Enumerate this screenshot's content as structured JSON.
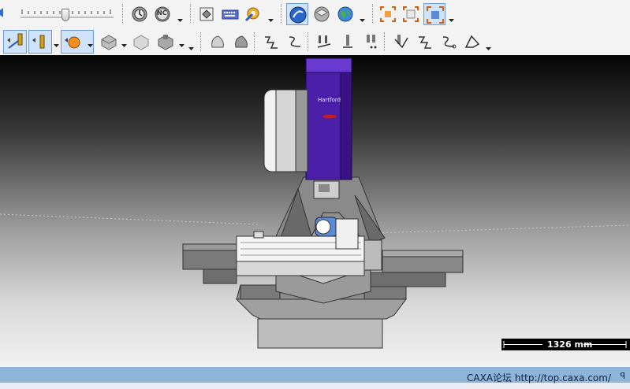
{
  "toolbar": {
    "zoom_slider": {
      "value": 0.48
    },
    "nc_button_label": "NC"
  },
  "viewport": {
    "background_top": "#050505",
    "background_bottom": "#f2f2f2",
    "machine_head_color": "#4b1fa8",
    "head_brand_text": "Hartford",
    "scale_label": "1326 mm"
  },
  "statusbar": {
    "text": "CAXA论坛  http://top.caxa.com/",
    "pin_icon": "pin-icon",
    "background": "#8eb4d8"
  }
}
